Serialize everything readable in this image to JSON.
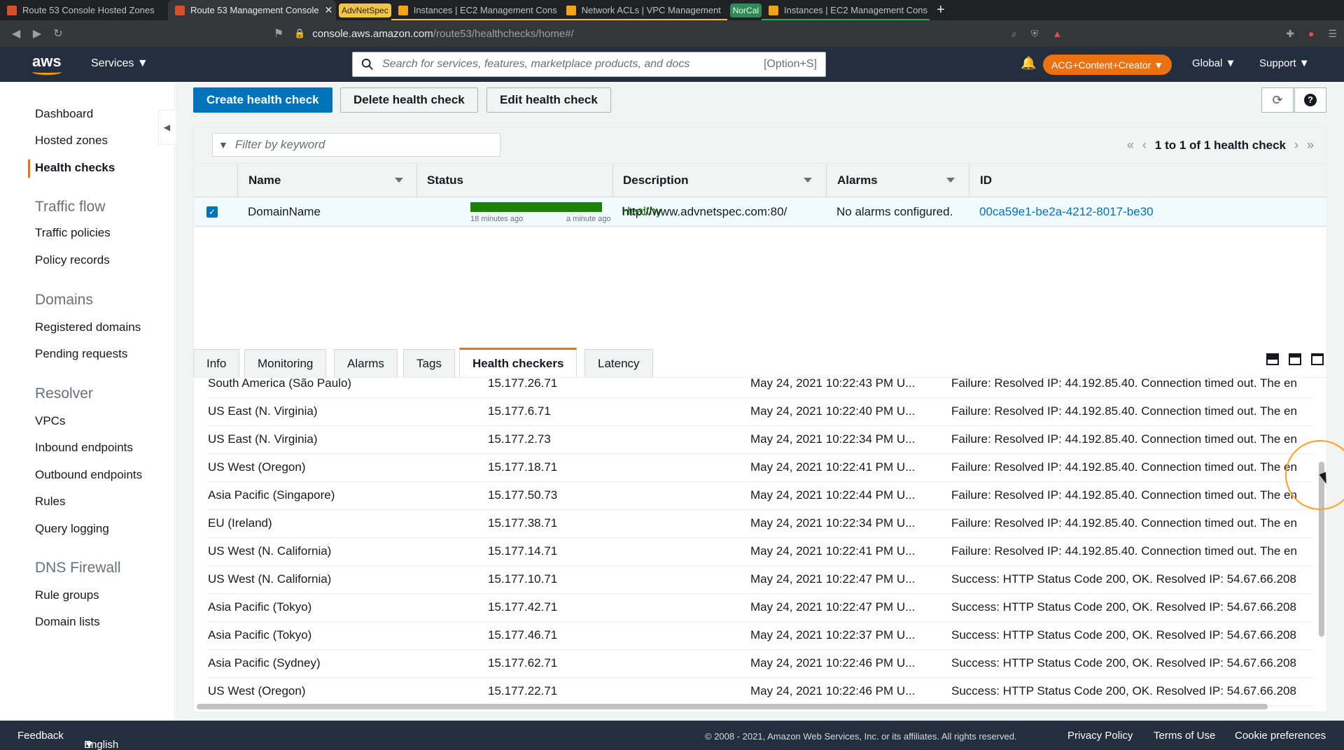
{
  "browser": {
    "tabs": [
      {
        "title": "Route 53 Console Hosted Zones"
      },
      {
        "title": "Route 53 Management Console"
      },
      {
        "title": "Instances | EC2 Management Cons"
      },
      {
        "title": "Network ACLs | VPC Management"
      },
      {
        "title": "Instances | EC2 Management Cons"
      }
    ],
    "groups": {
      "g1": "AdvNetSpec",
      "g2": "NorCal"
    },
    "url_host": "console.aws.amazon.com",
    "url_path": "/route53/healthchecks/home#/"
  },
  "header": {
    "logo": "aws",
    "services": "Services",
    "search_placeholder": "Search for services, features, marketplace products, and docs",
    "search_shortcut": "[Option+S]",
    "account": "ACG+Content+Creator",
    "region": "Global",
    "support": "Support"
  },
  "sidebar": {
    "items": [
      "Dashboard",
      "Hosted zones",
      "Health checks"
    ],
    "traffic_flow": {
      "title": "Traffic flow",
      "items": [
        "Traffic policies",
        "Policy records"
      ]
    },
    "domains": {
      "title": "Domains",
      "items": [
        "Registered domains",
        "Pending requests"
      ]
    },
    "resolver": {
      "title": "Resolver",
      "items": [
        "VPCs",
        "Inbound endpoints",
        "Outbound endpoints",
        "Rules",
        "Query logging"
      ]
    },
    "dns_firewall": {
      "title": "DNS Firewall",
      "items": [
        "Rule groups",
        "Domain lists"
      ]
    }
  },
  "toolbar": {
    "create": "Create health check",
    "delete": "Delete health check",
    "edit": "Edit health check"
  },
  "grid": {
    "filter_placeholder": "Filter by keyword",
    "pager_text": "1 to 1 of 1 health check",
    "columns": [
      "Name",
      "Status",
      "Description",
      "Alarms",
      "ID"
    ],
    "row": {
      "name": "DomainName",
      "status_time_start": "18 minutes ago",
      "status_time_end": "a minute ago",
      "status": "Healthy",
      "description": "http://www.advnetspec.com:80/",
      "alarms": "No alarms configured.",
      "id": "00ca59e1-be2a-4212-8017-be30"
    }
  },
  "panel": {
    "tabs": [
      "Info",
      "Monitoring",
      "Alarms",
      "Tags",
      "Health checkers",
      "Latency"
    ],
    "active_tab": "Health checkers",
    "rows": [
      {
        "region": "South America (São Paulo)",
        "ip": "15.177.26.71",
        "time": "May 24, 2021 10:22:43 PM U...",
        "status": "Failure: Resolved IP: 44.192.85.40. Connection timed out. The en"
      },
      {
        "region": "US East (N. Virginia)",
        "ip": "15.177.6.71",
        "time": "May 24, 2021 10:22:40 PM U...",
        "status": "Failure: Resolved IP: 44.192.85.40. Connection timed out. The en"
      },
      {
        "region": "US East (N. Virginia)",
        "ip": "15.177.2.73",
        "time": "May 24, 2021 10:22:34 PM U...",
        "status": "Failure: Resolved IP: 44.192.85.40. Connection timed out. The en"
      },
      {
        "region": "US West (Oregon)",
        "ip": "15.177.18.71",
        "time": "May 24, 2021 10:22:41 PM U...",
        "status": "Failure: Resolved IP: 44.192.85.40. Connection timed out. The en"
      },
      {
        "region": "Asia Pacific (Singapore)",
        "ip": "15.177.50.73",
        "time": "May 24, 2021 10:22:44 PM U...",
        "status": "Failure: Resolved IP: 44.192.85.40. Connection timed out. The en"
      },
      {
        "region": "EU (Ireland)",
        "ip": "15.177.38.71",
        "time": "May 24, 2021 10:22:34 PM U...",
        "status": "Failure: Resolved IP: 44.192.85.40. Connection timed out. The en"
      },
      {
        "region": "US West (N. California)",
        "ip": "15.177.14.71",
        "time": "May 24, 2021 10:22:41 PM U...",
        "status": "Failure: Resolved IP: 44.192.85.40. Connection timed out. The en"
      },
      {
        "region": "US West (N. California)",
        "ip": "15.177.10.71",
        "time": "May 24, 2021 10:22:47 PM U...",
        "status": "Success: HTTP Status Code 200, OK. Resolved IP: 54.67.66.208"
      },
      {
        "region": "Asia Pacific (Tokyo)",
        "ip": "15.177.42.71",
        "time": "May 24, 2021 10:22:47 PM U...",
        "status": "Success: HTTP Status Code 200, OK. Resolved IP: 54.67.66.208"
      },
      {
        "region": "Asia Pacific (Tokyo)",
        "ip": "15.177.46.71",
        "time": "May 24, 2021 10:22:37 PM U...",
        "status": "Success: HTTP Status Code 200, OK. Resolved IP: 54.67.66.208"
      },
      {
        "region": "Asia Pacific (Sydney)",
        "ip": "15.177.62.71",
        "time": "May 24, 2021 10:22:46 PM U...",
        "status": "Success: HTTP Status Code 200, OK. Resolved IP: 54.67.66.208"
      },
      {
        "region": "US West (Oregon)",
        "ip": "15.177.22.71",
        "time": "May 24, 2021 10:22:46 PM U...",
        "status": "Success: HTTP Status Code 200, OK. Resolved IP: 54.67.66.208"
      }
    ]
  },
  "footer": {
    "feedback": "Feedback",
    "language": "English (US)",
    "copyright": "© 2008 - 2021, Amazon Web Services, Inc. or its affiliates. All rights reserved.",
    "privacy": "Privacy Policy",
    "terms": "Terms of Use",
    "cookies": "Cookie preferences"
  },
  "colors": {
    "primary": "#0073bb",
    "healthy": "#1d8102",
    "accent": "#ec7211",
    "header": "#232f3e"
  }
}
